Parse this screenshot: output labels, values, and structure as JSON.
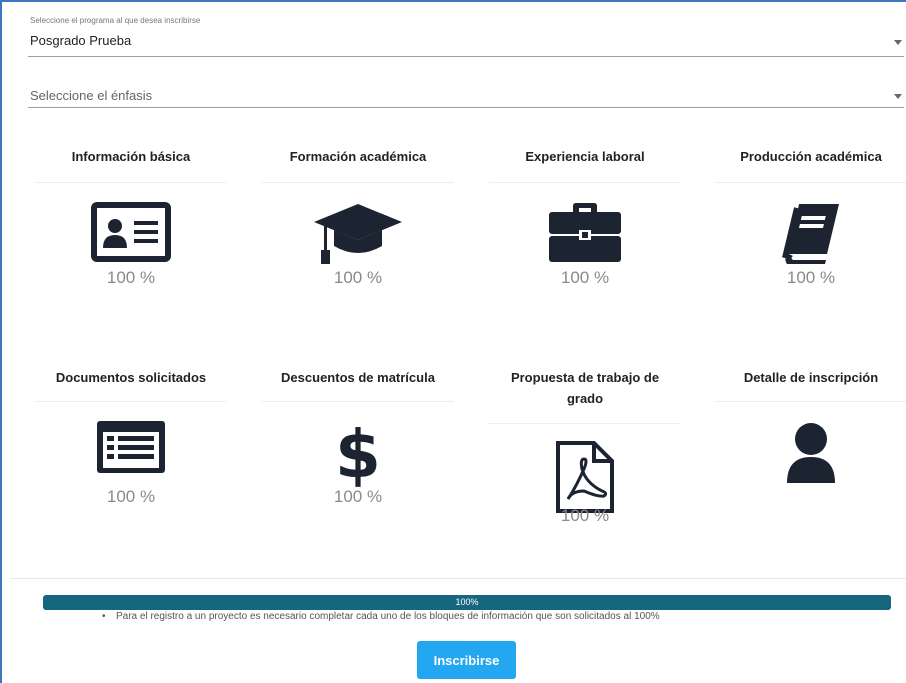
{
  "program_select": {
    "label": "Seleccione el programa al que desea inscribirse",
    "value": "Posgrado Prueba"
  },
  "emphasis_select": {
    "placeholder": "Seleccione el énfasis"
  },
  "cards": [
    {
      "title": "Información básica",
      "percent": "100 %",
      "icon": "id-card-icon"
    },
    {
      "title": "Formación académica",
      "percent": "100 %",
      "icon": "graduation-cap-icon"
    },
    {
      "title": "Experiencia laboral",
      "percent": "100 %",
      "icon": "briefcase-icon"
    },
    {
      "title": "Producción académica",
      "percent": "100 %",
      "icon": "book-icon"
    },
    {
      "title": "Documentos solicitados",
      "percent": "100 %",
      "icon": "list-document-icon"
    },
    {
      "title": "Descuentos de matrícula",
      "percent": "100 %",
      "icon": "dollar-icon"
    },
    {
      "title": "Propuesta de trabajo de grado",
      "percent": "100 %",
      "icon": "pdf-file-icon"
    },
    {
      "title": "Detalle de inscripción",
      "icon": "user-icon"
    }
  ],
  "progress": {
    "value": 1.0,
    "text": "100%"
  },
  "note": "Para el registro a un proyecto es necesario completar cada uno de los bloques de información que son solicitados al 100%",
  "submit_label": "Inscribirse",
  "colors": {
    "primary_button": "#22a7f0",
    "progress_bar": "#1b6f8a",
    "icon": "#1c2431"
  }
}
